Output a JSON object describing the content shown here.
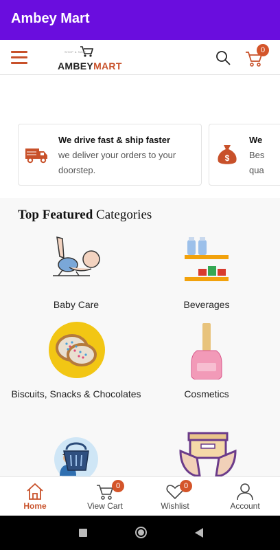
{
  "app": {
    "title": "Ambey Mart"
  },
  "header": {
    "logo_tagline": "SHOP & SAVE",
    "logo_part1": "AMBEY",
    "logo_part2": "MART",
    "cart_count": "0"
  },
  "features": [
    {
      "title": "We drive fast & ship faster",
      "desc": "we deliver your orders to your doorstep.",
      "icon": "truck-icon"
    },
    {
      "title": "We",
      "desc": "Bes qua",
      "icon": "money-bag-icon"
    }
  ],
  "categories": {
    "heading_bold": "Top Featured",
    "heading_rest": "Categories",
    "items": [
      {
        "label": "Baby Care",
        "icon": "baby-crawling-icon"
      },
      {
        "label": "Beverages",
        "icon": "bottles-shelf-icon"
      },
      {
        "label": "Biscuits, Snacks & Chocolates",
        "icon": "biscuits-icon"
      },
      {
        "label": "Cosmetics",
        "icon": "nail-polish-icon"
      },
      {
        "label": "",
        "icon": "shopping-basket-person-icon"
      },
      {
        "label": "",
        "icon": "box-in-hands-icon"
      }
    ]
  },
  "bottom_nav": {
    "items": [
      {
        "label": "Home",
        "icon": "home-icon",
        "active": true
      },
      {
        "label": "View Cart",
        "icon": "cart-icon",
        "badge": "0"
      },
      {
        "label": "Wishlist",
        "icon": "heart-icon",
        "badge": "0"
      },
      {
        "label": "Account",
        "icon": "user-icon"
      }
    ]
  },
  "colors": {
    "appbar": "#6a0dde",
    "accent": "#c8512a",
    "badge": "#d4552a"
  }
}
